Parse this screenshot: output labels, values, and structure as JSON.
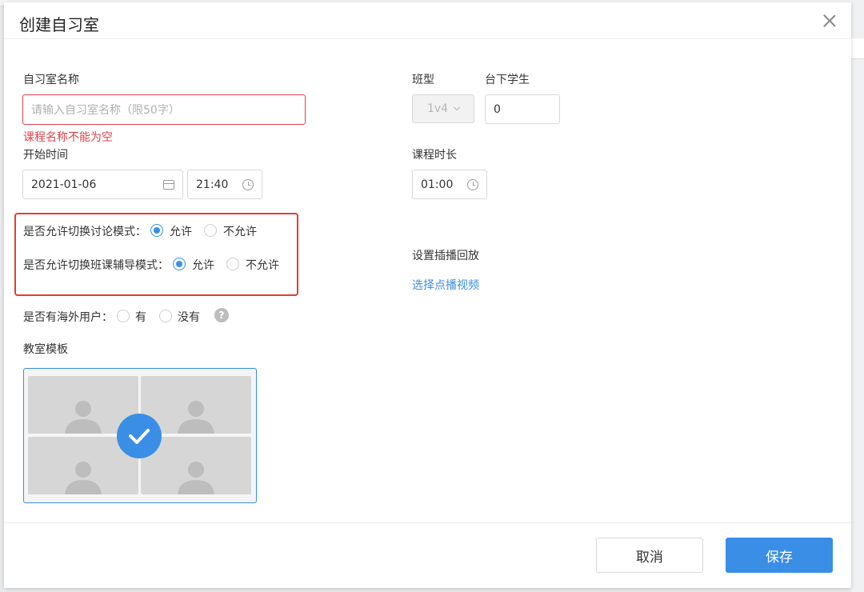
{
  "dialog": {
    "title": "创建自习室"
  },
  "form": {
    "room_name": {
      "label": "自习室名称",
      "placeholder": "请输入自习室名称（限50字）",
      "error": "课程名称不能为空"
    },
    "class_type": {
      "label": "班型",
      "value": "1v4"
    },
    "audience": {
      "label": "台下学生",
      "value": "0"
    },
    "start_time": {
      "label": "开始时间",
      "date": "2021-01-06",
      "time": "21:40"
    },
    "duration": {
      "label": "课程时长",
      "value": "01:00"
    },
    "discussion_mode": {
      "label": "是否允许切换讨论模式：",
      "options": [
        "允许",
        "不允许"
      ],
      "selected": "允许"
    },
    "tutoring_mode": {
      "label": "是否允许切换班课辅导模式：",
      "options": [
        "允许",
        "不允许"
      ],
      "selected": "允许"
    },
    "replay": {
      "label": "设置插播回放",
      "link": "选择点播视频"
    },
    "overseas": {
      "label": "是否有海外用户：",
      "options": [
        "有",
        "没有"
      ],
      "help": "?"
    },
    "template": {
      "label": "教室模板"
    }
  },
  "footer": {
    "cancel": "取消",
    "save": "保存"
  },
  "colors": {
    "primary": "#3a8ee6",
    "error": "#e0424c",
    "highlight": "#e0402f"
  }
}
